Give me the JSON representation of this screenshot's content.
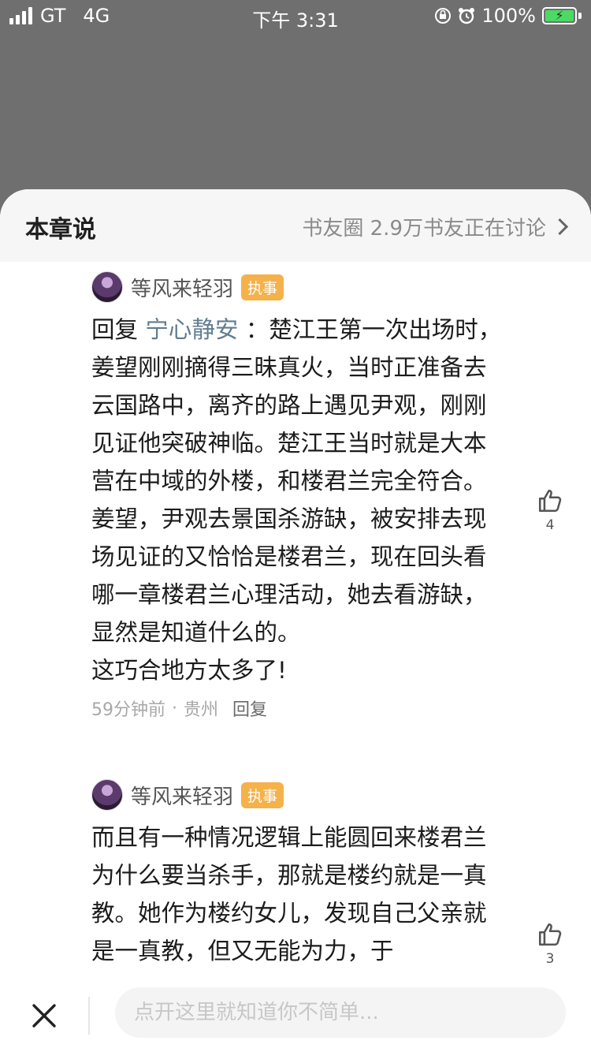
{
  "status_bar": {
    "carrier": "GT",
    "network": "4G",
    "time": "下午 3:31",
    "battery": "100%",
    "battery_color": "#4cd964"
  },
  "sheet": {
    "title": "本章说",
    "header_link": "书友圈 2.9万书友正在讨论"
  },
  "comments": [
    {
      "username": "等风来轻羽",
      "badge": "执事",
      "reply_prefix": "回复",
      "reply_to": "宁心静安",
      "text": " ：楚江王第一次出场时，姜望刚刚摘得三昧真火，当时正准备去云国路中，离齐的路上遇见尹观，刚刚见证他突破神临。楚江王当时就是大本营在中域的外楼，和楼君兰完全符合。姜望，尹观去景国杀游缺，被安排去现场见证的又恰恰是楼君兰，现在回头看哪一章楼君兰心理活动，她去看游缺，显然是知道什么的。\n这巧合地方太多了!",
      "time": "59分钟前",
      "location": "贵州",
      "reply_label": "回复",
      "likes": "4"
    },
    {
      "username": "等风来轻羽",
      "badge": "执事",
      "text": "而且有一种情况逻辑上能圆回来楼君兰为什么要当杀手，那就是楼约就是一真教。她作为楼约女儿，发现自己父亲就是一真教，但又无能为力，于",
      "likes": "3"
    }
  ],
  "input": {
    "placeholder": "点开这里就知道你不简单..."
  },
  "icons": {
    "like": "thumbs-up-icon",
    "close": "close-icon",
    "chevron": "chevron-right-icon"
  }
}
